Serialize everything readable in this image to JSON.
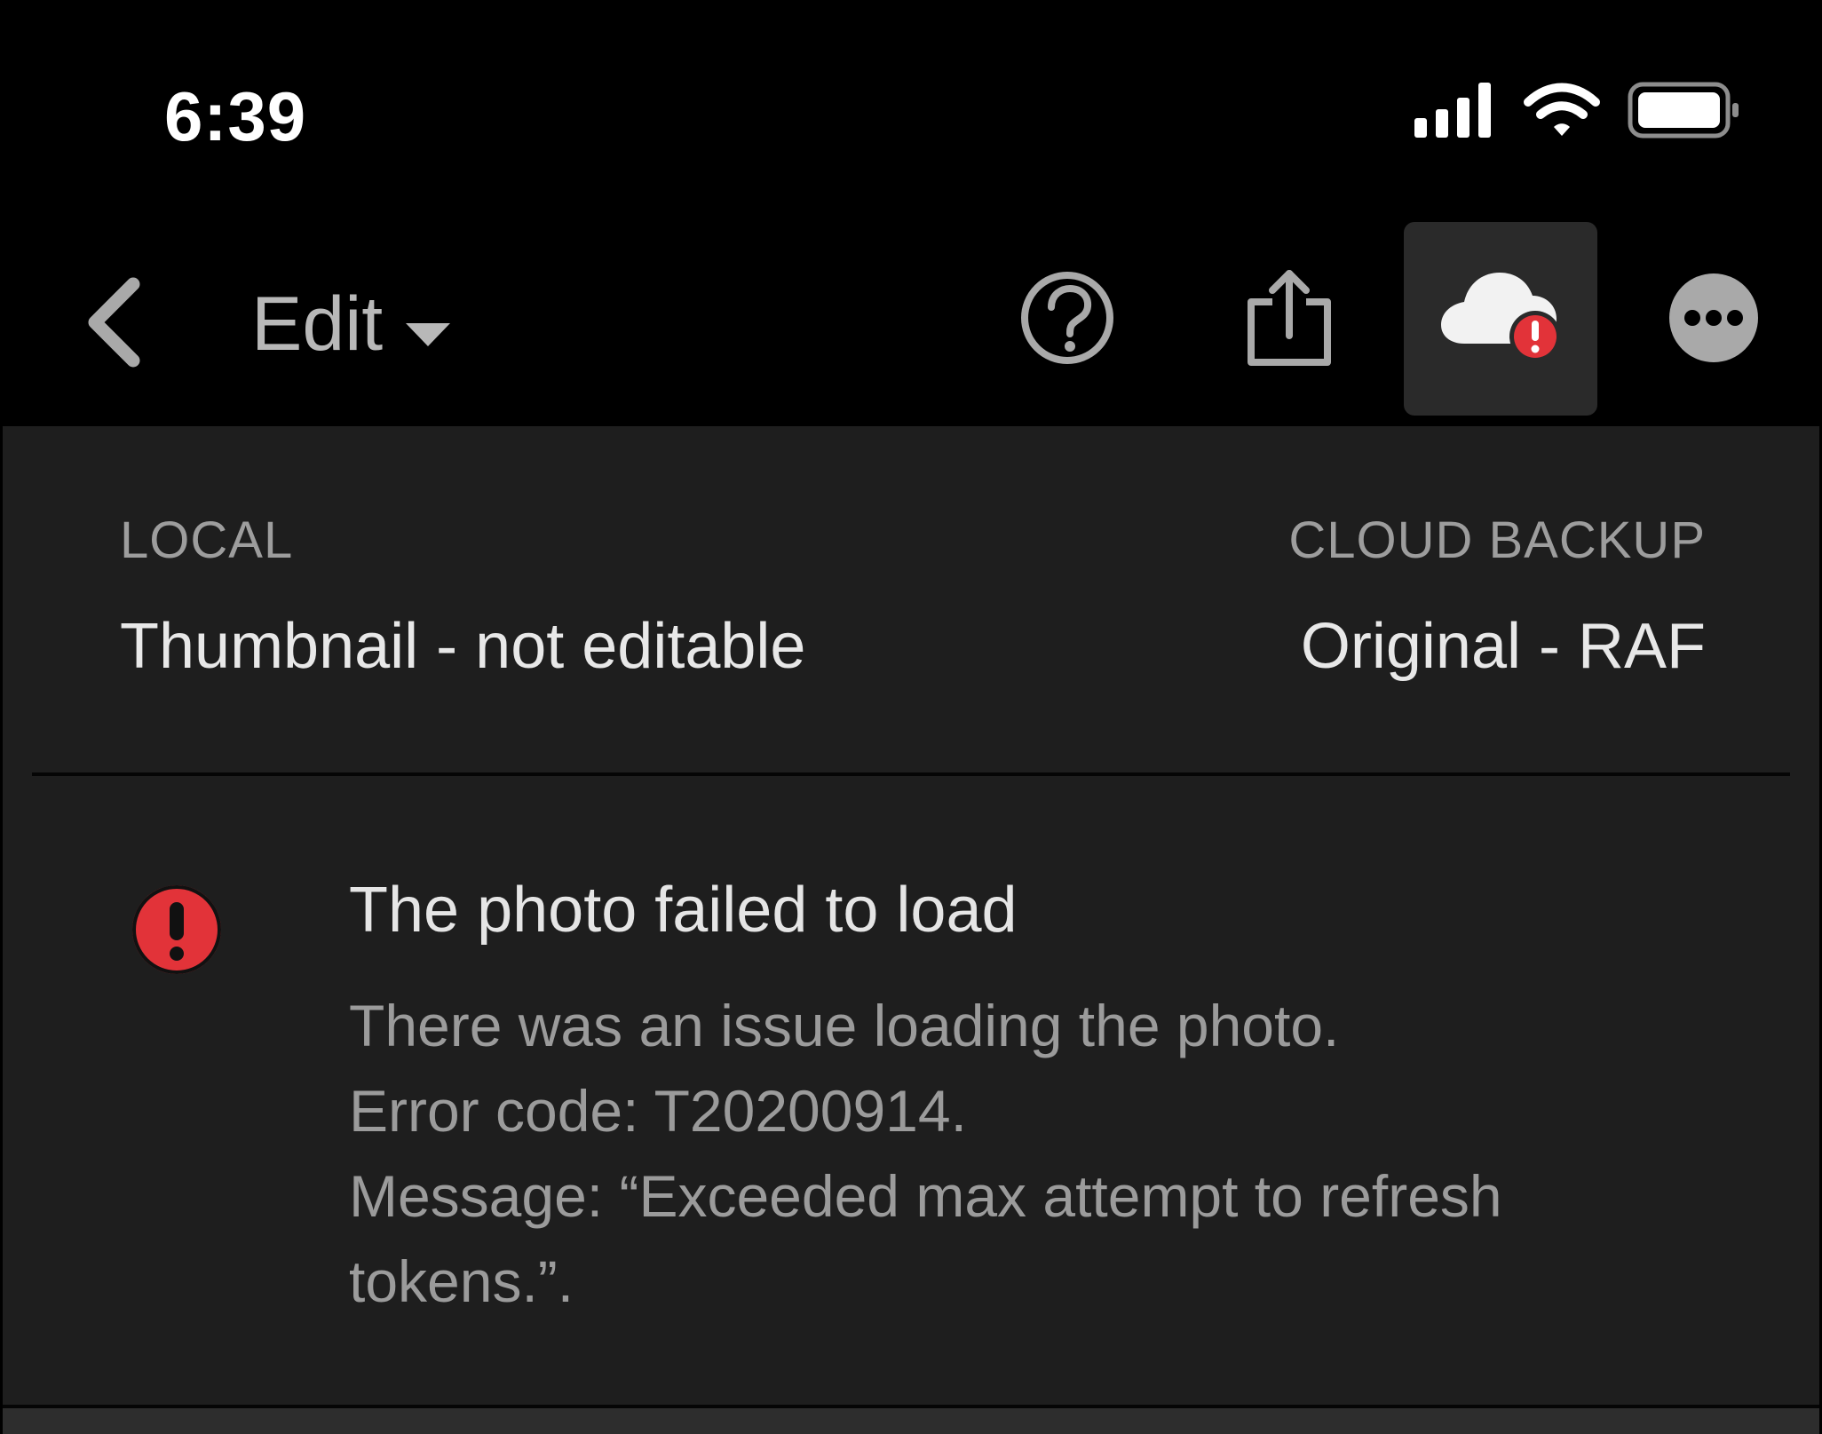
{
  "status_bar": {
    "time": "6:39",
    "icons": [
      "cellular-signal-icon",
      "wifi-icon",
      "battery-icon"
    ]
  },
  "toolbar": {
    "back_icon": "chevron-left-icon",
    "edit_label": "Edit",
    "dropdown_icon": "caret-down-icon",
    "actions": [
      "help-icon",
      "share-icon",
      "cloud-error-icon",
      "more-icon"
    ]
  },
  "sources": {
    "local": {
      "label": "LOCAL",
      "value": "Thumbnail - not editable"
    },
    "cloud_backup": {
      "label": "CLOUD BACKUP",
      "value": "Original - RAF"
    }
  },
  "error": {
    "icon": "error-alert-icon",
    "title": "The photo failed to load",
    "lines": [
      "There was an issue loading the photo.",
      "Error code: T20200914.",
      "Message: “Exceeded max attempt to refresh",
      "tokens.”."
    ]
  },
  "colors": {
    "background": "#000000",
    "panel": "#1e1e1e",
    "active_button": "#2a2a2a",
    "error_red": "#e23339",
    "muted_text": "#9b9b9b"
  }
}
